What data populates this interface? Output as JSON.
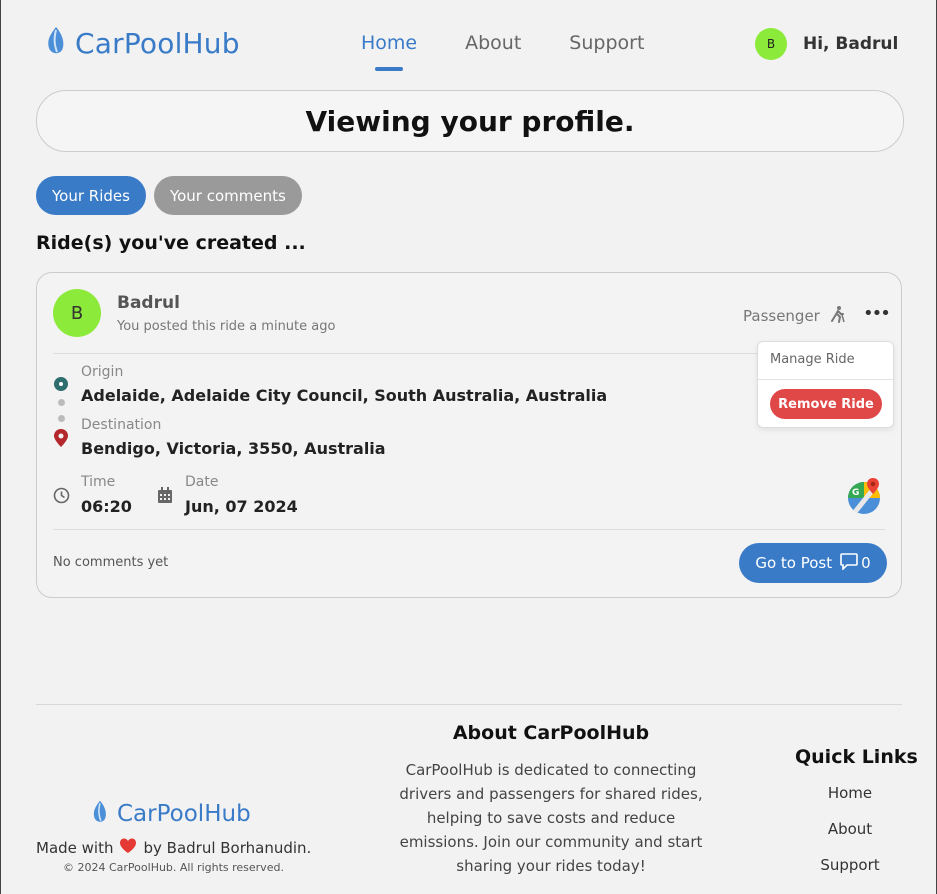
{
  "brand": {
    "name": "CarPoolHub",
    "color": "#3a7bc8"
  },
  "nav": {
    "items": [
      "Home",
      "About",
      "Support"
    ],
    "active": "Home"
  },
  "user": {
    "initial": "B",
    "greeting": "Hi, Badrul"
  },
  "profile": {
    "banner": "Viewing your profile.",
    "tabs": [
      "Your Rides",
      "Your comments"
    ],
    "section_title": "Ride(s) you've created ..."
  },
  "ride": {
    "poster_initial": "B",
    "poster_name": "Badrul",
    "posted_text": "You posted this ride a minute ago",
    "role": "Passenger",
    "origin_label": "Origin",
    "origin": "Adelaide, Adelaide City Council, South Australia, Australia",
    "destination_label": "Destination",
    "destination": "Bendigo, Victoria, 3550, Australia",
    "time_label": "Time",
    "time": "06:20",
    "date_label": "Date",
    "date": "Jun, 07 2024",
    "comments_status": "No comments yet",
    "go_to_post": "Go to Post",
    "comment_count": "0"
  },
  "dropdown": {
    "manage": "Manage Ride",
    "remove": "Remove Ride"
  },
  "footer": {
    "made_prefix": "Made with",
    "made_suffix": "by Badrul Borhanudin.",
    "copyright": "© 2024 CarPoolHub. All rights reserved.",
    "about_title": "About CarPoolHub",
    "about_text": "CarPoolHub is dedicated to connecting drivers and passengers for shared rides, helping to save costs and reduce emissions. Join our community and start sharing your rides today!",
    "quick_links_title": "Quick Links",
    "links": [
      "Home",
      "About",
      "Support"
    ]
  }
}
